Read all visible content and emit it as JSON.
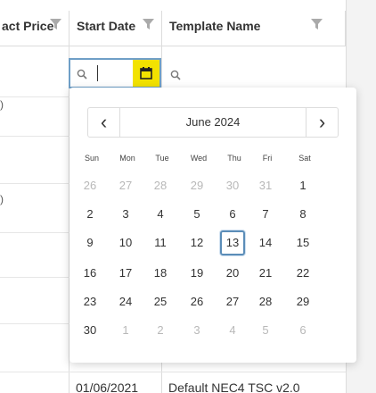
{
  "grid": {
    "columns": [
      {
        "label": "act Price"
      },
      {
        "label": "Start Date"
      },
      {
        "label": "Template Name"
      }
    ],
    "row_marks": [
      ")",
      ")"
    ],
    "bottom_row": {
      "start_date": "01/06/2021",
      "template_name": "Default NEC4 TSC v2.0"
    }
  },
  "filter": {
    "start_date_value": ""
  },
  "calendar": {
    "month_label": "June 2024",
    "prev_label": "‹",
    "next_label": "›",
    "weekdays": [
      "Sun",
      "Mon",
      "Tue",
      "Wed",
      "Thu",
      "Fri",
      "Sat"
    ],
    "weeks": [
      [
        "26",
        "27",
        "28",
        "29",
        "30",
        "31",
        "1"
      ],
      [
        "2",
        "3",
        "4",
        "5",
        "6",
        "7",
        "8"
      ],
      [
        "9",
        "10",
        "11",
        "12",
        "13",
        "14",
        "15"
      ],
      [
        "16",
        "17",
        "18",
        "19",
        "20",
        "21",
        "22"
      ],
      [
        "23",
        "24",
        "25",
        "26",
        "27",
        "28",
        "29"
      ],
      [
        "30",
        "1",
        "2",
        "3",
        "4",
        "5",
        "6"
      ]
    ],
    "muted": [
      [
        true,
        true,
        true,
        true,
        true,
        true,
        false
      ],
      [
        false,
        false,
        false,
        false,
        false,
        false,
        false
      ],
      [
        false,
        false,
        false,
        false,
        false,
        false,
        false
      ],
      [
        false,
        false,
        false,
        false,
        false,
        false,
        false
      ],
      [
        false,
        false,
        false,
        false,
        false,
        false,
        false
      ],
      [
        false,
        true,
        true,
        true,
        true,
        true,
        true
      ]
    ],
    "selected_day": "13"
  },
  "colors": {
    "accent_yellow": "#f2e200",
    "focus_blue": "#5b8db8"
  }
}
